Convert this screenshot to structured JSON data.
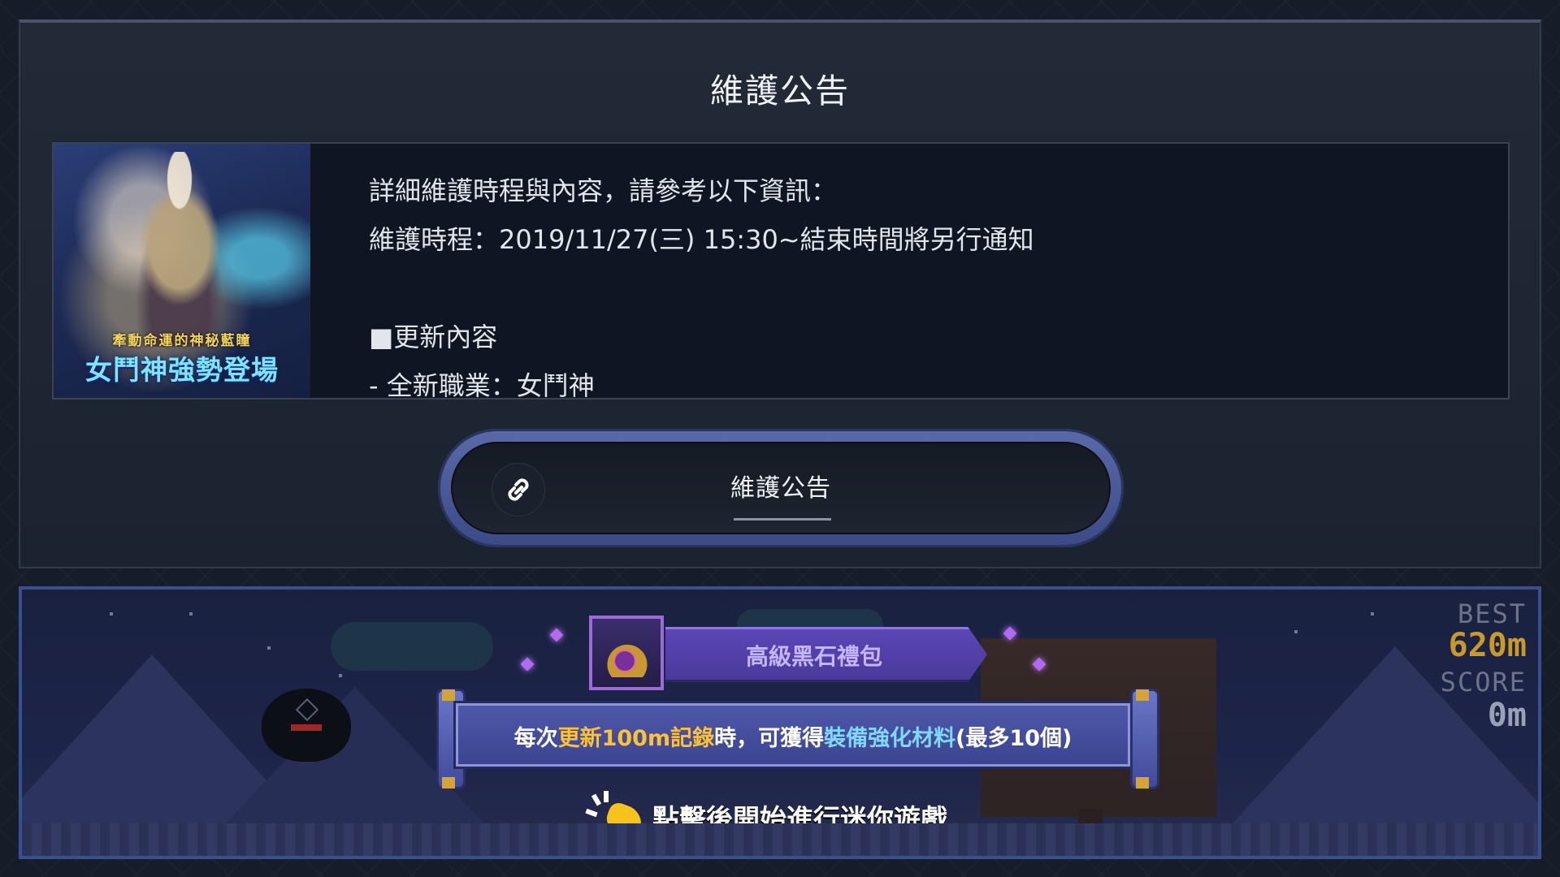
{
  "notice": {
    "title": "維護公告",
    "banner": {
      "subtitle": "牽動命運的神秘藍瞳",
      "title": "女鬥神強勢登場"
    },
    "lines": [
      "詳細維護時程與內容，請參考以下資訊：",
      "維護時程：2019/11/27(三) 15:30~結束時間將另行通知",
      "",
      "■更新內容",
      "- 全新職業：女鬥神"
    ],
    "link_button": {
      "icon": "link-icon",
      "label": "維護公告"
    }
  },
  "minigame": {
    "item_name": "高級黑石禮包",
    "reward": {
      "part1": "每次",
      "part2": "更新100m記錄",
      "part3": "時，可獲得",
      "part4": "裝備強化材料",
      "part5": "(最多10個)"
    },
    "tap_prompt": "點擊後開始進行迷你遊戲",
    "best_label": "BEST",
    "best_value": "620m",
    "score_label": "SCORE",
    "score_value": "0m",
    "colors": {
      "highlight_gold": "#ffc233",
      "highlight_blue": "#7fd8ff",
      "frame": "#3b4f8f"
    }
  }
}
